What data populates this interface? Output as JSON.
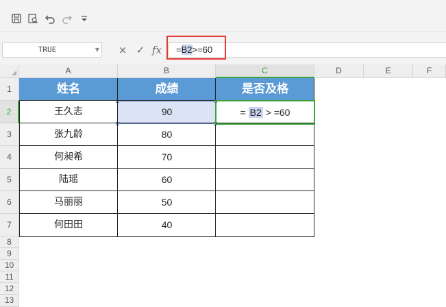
{
  "toolbar": {
    "icons": [
      "save-icon",
      "print-preview-icon",
      "undo-icon",
      "redo-icon",
      "customize-dropdown-icon"
    ]
  },
  "name_box": {
    "value": "TRUE"
  },
  "formula_bar": {
    "cancel_glyph": "×",
    "confirm_glyph": "✓",
    "fx_label": "fx",
    "formula_prefix": "=",
    "formula_ref": "B2",
    "formula_suffix": ">=60"
  },
  "columns": [
    {
      "letter": "A",
      "active": false
    },
    {
      "letter": "B",
      "active": false
    },
    {
      "letter": "C",
      "active": true
    },
    {
      "letter": "D",
      "active": false
    },
    {
      "letter": "E",
      "active": false
    },
    {
      "letter": "F",
      "active": false
    }
  ],
  "rows": [
    "1",
    "2",
    "3",
    "4",
    "5",
    "6",
    "7",
    "8",
    "9",
    "10",
    "11",
    "12",
    "13"
  ],
  "active_row": "2",
  "table": {
    "headers": [
      "姓名",
      "成绩",
      "是否及格"
    ],
    "header_color": "#5b9bd5",
    "records": [
      {
        "name": "王久志",
        "score": "90"
      },
      {
        "name": "张九龄",
        "score": "80"
      },
      {
        "name": "何昶希",
        "score": "70"
      },
      {
        "name": "陆瑶",
        "score": "60"
      },
      {
        "name": "马丽丽",
        "score": "50"
      },
      {
        "name": "何田田",
        "score": "40"
      }
    ]
  },
  "editing_cell": {
    "address": "C2",
    "prefix": "= ",
    "ref": "B2",
    "suffix": " > =60"
  },
  "colors": {
    "active_green": "#3aa43a",
    "highlight_red": "#e53935",
    "selection_blue": "#5b7ec9"
  }
}
